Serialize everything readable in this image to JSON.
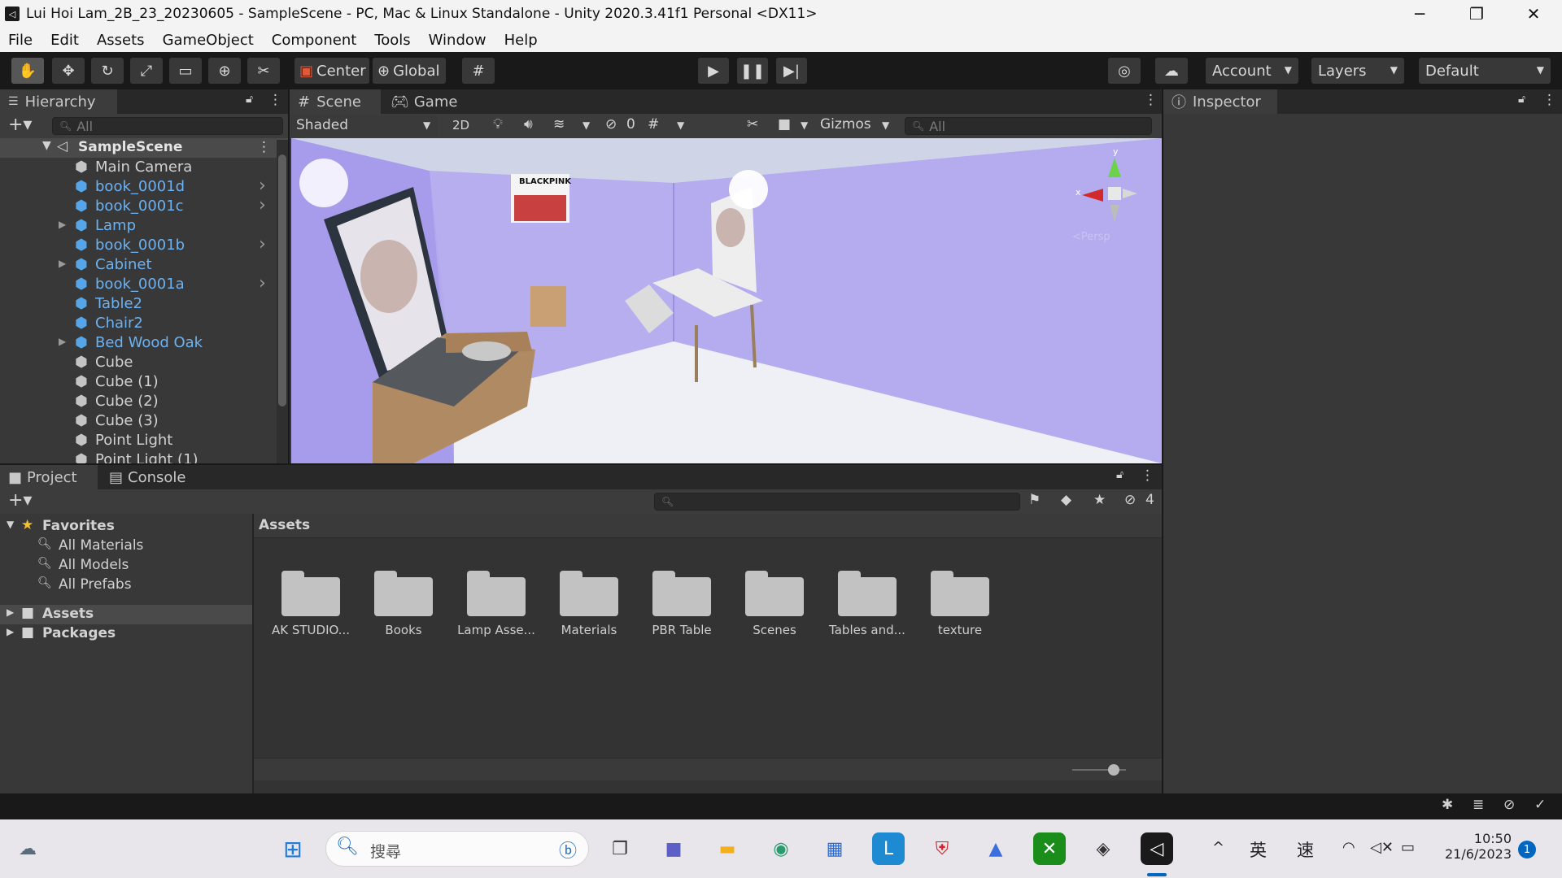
{
  "window": {
    "title": "Lui Hoi Lam_2B_23_20230605 - SampleScene - PC, Mac & Linux Standalone - Unity 2020.3.41f1 Personal <DX11>",
    "minimize": "─",
    "maximize": "❐",
    "close": "✕"
  },
  "menu": [
    "File",
    "Edit",
    "Assets",
    "GameObject",
    "Component",
    "Tools",
    "Window",
    "Help"
  ],
  "toolbar": {
    "center_label": "Center",
    "global_label": "Global",
    "account_label": "Account",
    "layers_label": "Layers",
    "layout_label": "Default"
  },
  "hierarchy": {
    "tab_label": "Hierarchy",
    "search_placeholder": "All",
    "scene_name": "SampleScene",
    "items": [
      {
        "label": "Main Camera",
        "prefab": false,
        "expand": false,
        "more": false
      },
      {
        "label": "book_0001d",
        "prefab": true,
        "expand": false,
        "more": true
      },
      {
        "label": "book_0001c",
        "prefab": true,
        "expand": false,
        "more": true
      },
      {
        "label": "Lamp",
        "prefab": true,
        "expand": true,
        "more": false
      },
      {
        "label": "book_0001b",
        "prefab": true,
        "expand": false,
        "more": true
      },
      {
        "label": "Cabinet",
        "prefab": true,
        "expand": true,
        "more": false
      },
      {
        "label": "book_0001a",
        "prefab": true,
        "expand": false,
        "more": true
      },
      {
        "label": "Table2",
        "prefab": true,
        "expand": false,
        "more": false
      },
      {
        "label": "Chair2",
        "prefab": true,
        "expand": false,
        "more": false
      },
      {
        "label": "Bed Wood Oak",
        "prefab": true,
        "expand": true,
        "more": false
      },
      {
        "label": "Cube",
        "prefab": false,
        "expand": false,
        "more": false
      },
      {
        "label": "Cube (1)",
        "prefab": false,
        "expand": false,
        "more": false
      },
      {
        "label": "Cube (2)",
        "prefab": false,
        "expand": false,
        "more": false
      },
      {
        "label": "Cube (3)",
        "prefab": false,
        "expand": false,
        "more": false
      },
      {
        "label": "Point Light",
        "prefab": false,
        "expand": false,
        "more": false
      },
      {
        "label": "Point Light (1)",
        "prefab": false,
        "expand": false,
        "more": false
      }
    ]
  },
  "scene": {
    "tab_scene": "Scene",
    "tab_game": "Game",
    "shading": "Shaded",
    "mode_2d": "2D",
    "hidden_count": "0",
    "gizmos": "Gizmos",
    "search_placeholder": "All",
    "poster_text": "BLACKPINK",
    "axis_x": "x",
    "axis_y": "y",
    "persp_label": "<Persp"
  },
  "inspector": {
    "tab_label": "Inspector"
  },
  "project": {
    "tab_project": "Project",
    "tab_console": "Console",
    "hidden_count": "4",
    "favorites_label": "Favorites",
    "favorites": [
      "All Materials",
      "All Models",
      "All Prefabs"
    ],
    "roots": [
      "Assets",
      "Packages"
    ],
    "breadcrumb": "Assets",
    "folders": [
      "AK STUDIO...",
      "Books",
      "Lamp Asse...",
      "Materials",
      "PBR Table",
      "Scenes",
      "Tables and...",
      "texture"
    ]
  },
  "taskbar": {
    "search_text": "搜尋",
    "ime_lang": "英",
    "ime_mode": "速",
    "time": "10:50",
    "date": "21/6/2023",
    "notification_count": "1",
    "colors": {
      "accent": "#0067c0"
    }
  }
}
